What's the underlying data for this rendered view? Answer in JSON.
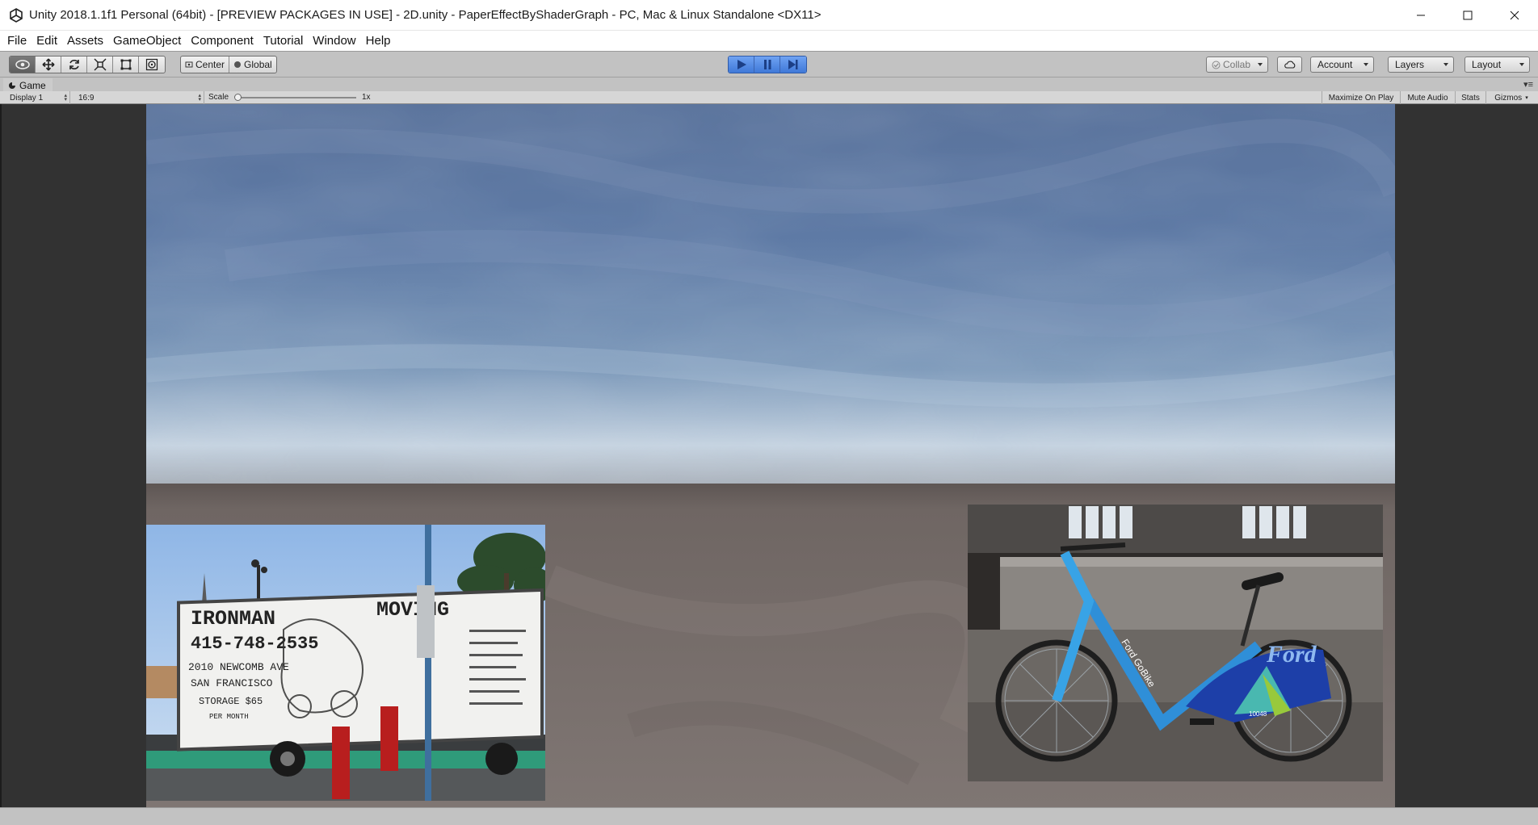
{
  "window": {
    "title": "Unity 2018.1.1f1 Personal (64bit) - [PREVIEW PACKAGES IN USE] - 2D.unity - PaperEffectByShaderGraph - PC, Mac & Linux Standalone <DX11>",
    "app_icon": "unity-logo-icon",
    "controls": [
      "minimize-icon",
      "maximize-icon",
      "close-icon"
    ]
  },
  "menu": [
    "File",
    "Edit",
    "Assets",
    "GameObject",
    "Component",
    "Tutorial",
    "Window",
    "Help"
  ],
  "toolbar": {
    "transform_tools": [
      {
        "icon": "hand-eye-icon",
        "active": true
      },
      {
        "icon": "move-icon",
        "active": false
      },
      {
        "icon": "rotate-icon",
        "active": false
      },
      {
        "icon": "scale-icon",
        "active": false
      },
      {
        "icon": "rect-icon",
        "active": false
      },
      {
        "icon": "transform-icon",
        "active": false
      }
    ],
    "pivot": {
      "label": "Center",
      "icon": "pivot-icon"
    },
    "space": {
      "label": "Global",
      "icon": "globe-icon"
    },
    "playback": [
      {
        "icon": "play-icon",
        "active": true
      },
      {
        "icon": "pause-icon",
        "active": true
      },
      {
        "icon": "step-icon",
        "active": true
      }
    ],
    "collab": "Collab",
    "cloud_icon": "cloud-icon",
    "account": "Account",
    "layers": "Layers",
    "layout": "Layout"
  },
  "game_view": {
    "tab_label": "Game",
    "tab_icon": "game-tab-icon",
    "display": "Display 1",
    "aspect": "16:9",
    "scale_label": "Scale",
    "scale_value": "1x",
    "scale_slider_fraction": 0.0,
    "buttons": [
      "Maximize On Play",
      "Mute Audio",
      "Stats",
      "Gizmos"
    ],
    "scene": {
      "truck_sign": {
        "line1": "IRONMAN",
        "line1b": "MOVING",
        "phone": "415-748-2535",
        "addr1": "2010 NEWCOMB AVE",
        "addr2": "SAN FRANCISCO",
        "addr3": "STORAGE $65",
        "addr4": "PER MONTH"
      },
      "bike_brand": "Ford",
      "bike_tag": "Ford GoBike",
      "bike_id": "10048"
    }
  },
  "colors": {
    "sky_top": "#5a739c",
    "sky_horizon": "#c9d6e2",
    "ground": "#7c7370",
    "editor_gray": "#c2c2c2",
    "play_blue": "#4a86e8"
  }
}
